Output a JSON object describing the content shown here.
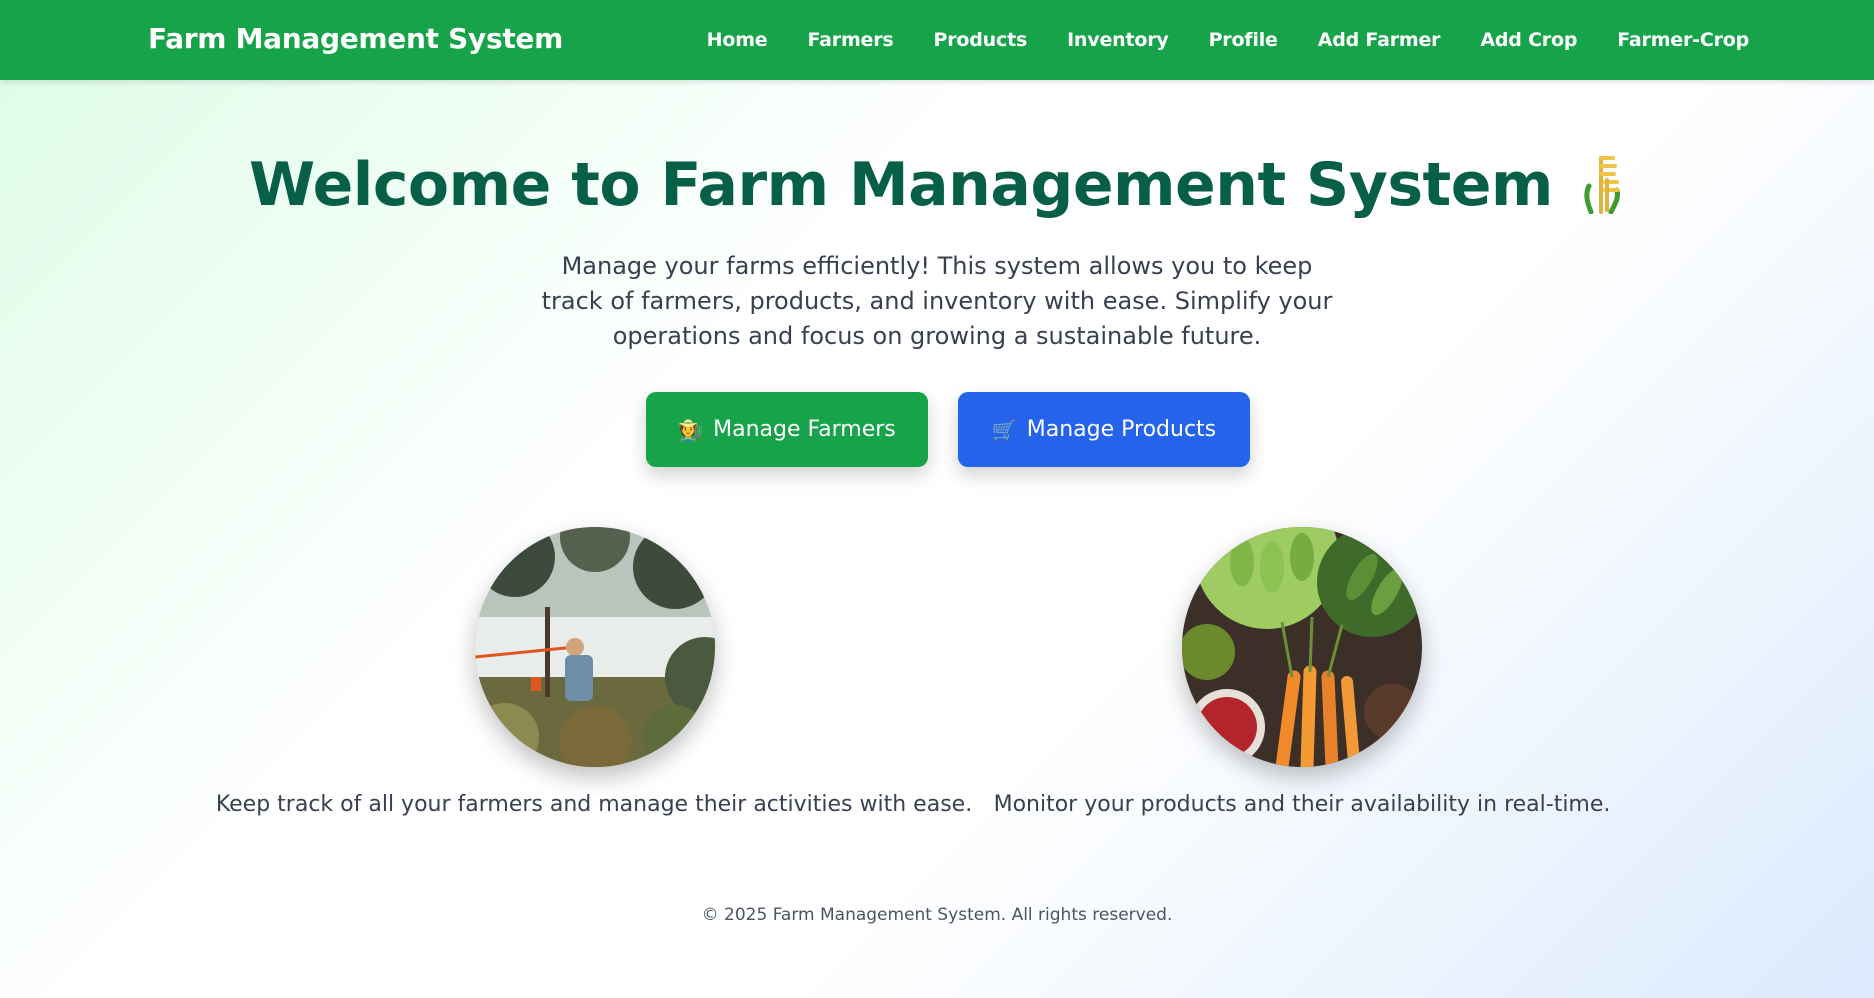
{
  "nav": {
    "brand": "Farm Management System",
    "links": [
      "Home",
      "Farmers",
      "Products",
      "Inventory",
      "Profile",
      "Add Farmer",
      "Add Crop",
      "Farmer-Crop"
    ]
  },
  "hero": {
    "title": "Welcome to Farm Management System",
    "title_icon": "sheaf-of-rice-icon",
    "description": "Manage your farms efficiently! This system allows you to keep track of farmers, products, and inventory with ease. Simplify your operations and focus on growing a sustainable future."
  },
  "buttons": {
    "farmers": {
      "icon": "farmer-icon",
      "icon_glyph": "🧑‍🌾",
      "label": "Manage Farmers"
    },
    "products": {
      "icon": "shopping-cart-icon",
      "icon_glyph": "🛒",
      "label": "Manage Products"
    }
  },
  "features": [
    {
      "image": "farmer-photo",
      "text": "Keep track of all your farmers and manage their activities with ease."
    },
    {
      "image": "vegetables-photo",
      "text": "Monitor your products and their availability in real-time."
    }
  ],
  "footer": {
    "text": "© 2025 Farm Management System. All rights reserved."
  },
  "colors": {
    "nav": "#16a34a",
    "title": "#065f46",
    "farmers_button": "#16a34a",
    "products_button": "#2563eb"
  }
}
